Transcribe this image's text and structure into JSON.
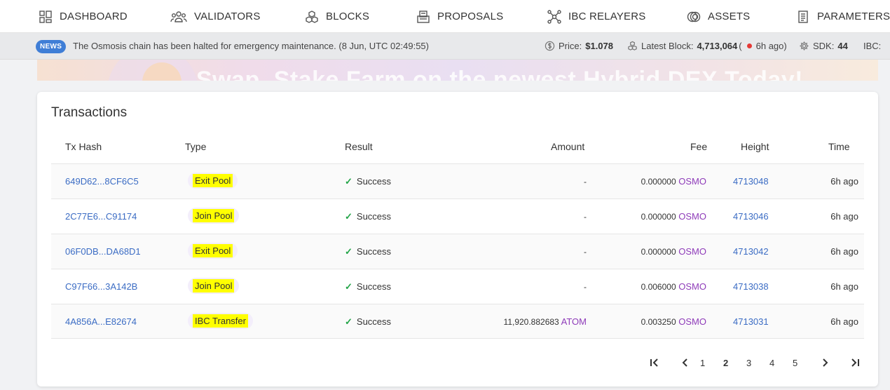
{
  "nav": {
    "items": [
      {
        "label": "DASHBOARD",
        "icon": "grid-icon"
      },
      {
        "label": "VALIDATORS",
        "icon": "users-icon"
      },
      {
        "label": "BLOCKS",
        "icon": "cubes-icon"
      },
      {
        "label": "PROPOSALS",
        "icon": "ballot-box-icon"
      },
      {
        "label": "IBC RELAYERS",
        "icon": "network-icon"
      },
      {
        "label": "ASSETS",
        "icon": "coins-icon"
      },
      {
        "label": "PARAMETERS",
        "icon": "document-icon"
      }
    ]
  },
  "news": {
    "badge": "NEWS",
    "text": "The Osmosis chain has been halted for emergency maintenance. (8 Jun, UTC 02:49:55)"
  },
  "stats": {
    "price_label": "Price:",
    "price_value": "$1.078",
    "block_label": "Latest Block:",
    "block_value": "4,713,064",
    "block_open": "(",
    "block_age": "6h ago)",
    "sdk_label": "SDK:",
    "sdk_value": "44",
    "ibc_label": "IBC:"
  },
  "banner": {
    "text": "Swap, Stake Farm on the newest Hybrid DEX Today!"
  },
  "transactions": {
    "title": "Transactions",
    "columns": {
      "hash": "Tx Hash",
      "type": "Type",
      "result": "Result",
      "amount": "Amount",
      "fee": "Fee",
      "height": "Height",
      "time": "Time"
    },
    "rows": [
      {
        "hash": "649D62...8CF6C5",
        "type": "Exit Pool",
        "result": "Success",
        "amount_value": "-",
        "amount_denom": "",
        "fee_value": "0.000000",
        "fee_denom": "OSMO",
        "height": "4713048",
        "time": "6h ago"
      },
      {
        "hash": "2C77E6...C91174",
        "type": "Join Pool",
        "result": "Success",
        "amount_value": "-",
        "amount_denom": "",
        "fee_value": "0.000000",
        "fee_denom": "OSMO",
        "height": "4713046",
        "time": "6h ago"
      },
      {
        "hash": "06F0DB...DA68D1",
        "type": "Exit Pool",
        "result": "Success",
        "amount_value": "-",
        "amount_denom": "",
        "fee_value": "0.000000",
        "fee_denom": "OSMO",
        "height": "4713042",
        "time": "6h ago"
      },
      {
        "hash": "C97F66...3A142B",
        "type": "Join Pool",
        "result": "Success",
        "amount_value": "-",
        "amount_denom": "",
        "fee_value": "0.006000",
        "fee_denom": "OSMO",
        "height": "4713038",
        "time": "6h ago"
      },
      {
        "hash": "4A856A...E82674",
        "type": "IBC Transfer",
        "result": "Success",
        "amount_value": "11,920.882683",
        "amount_denom": "ATOM",
        "fee_value": "0.003250",
        "fee_denom": "OSMO",
        "height": "4713031",
        "time": "6h ago"
      }
    ]
  },
  "pagination": {
    "pages": [
      "1",
      "2",
      "3",
      "4",
      "5"
    ],
    "current": "2"
  },
  "colors": {
    "link": "#3b6cc4",
    "denom": "#8e3bb9",
    "success": "#22a447",
    "highlight": "#ffff00",
    "news_badge": "#3f7ed6"
  }
}
